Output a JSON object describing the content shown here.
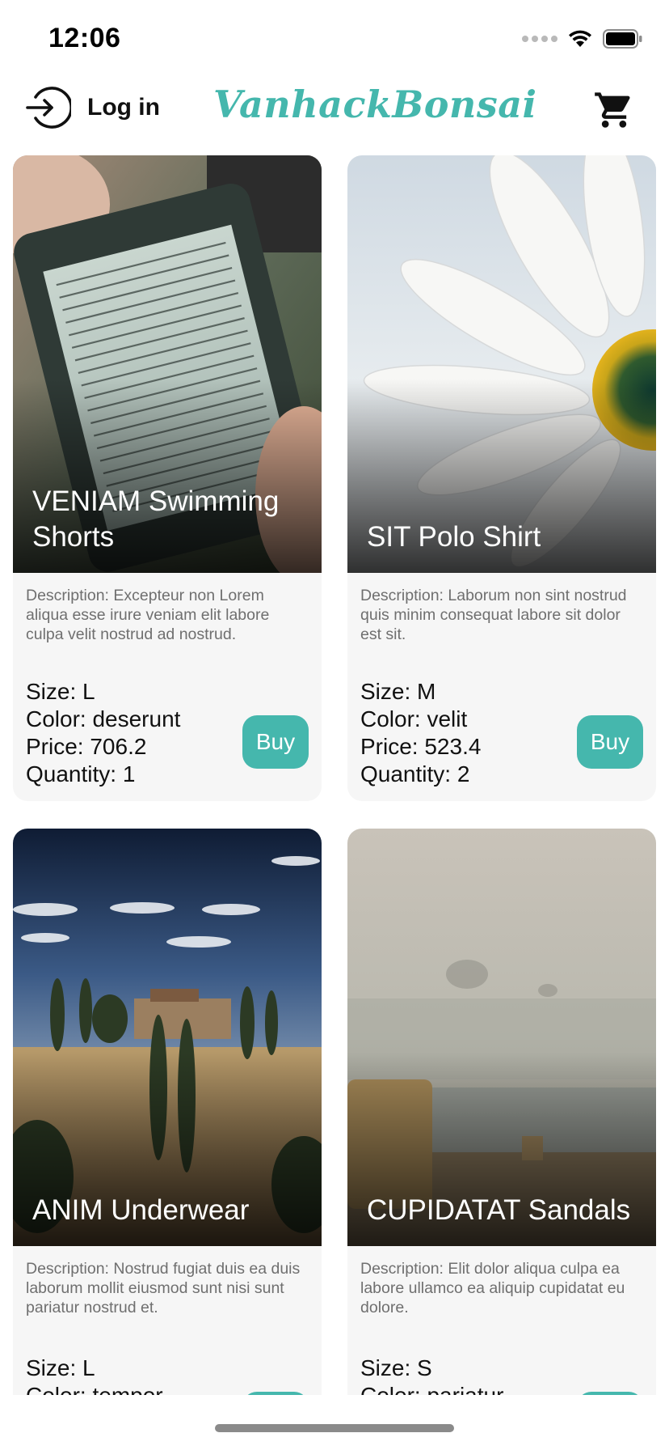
{
  "status_bar": {
    "time": "12:06"
  },
  "header": {
    "login_label": "Log in",
    "brand": "VanhackBonsai",
    "brand_color": "#45b7ad"
  },
  "icons": {
    "login": "login-arrow-icon",
    "cart": "shopping-cart-icon",
    "wifi": "wifi-icon",
    "battery": "battery-icon"
  },
  "labels": {
    "size": "Size: ",
    "color": "Color: ",
    "price": "Price: ",
    "quantity": "Quantity: ",
    "buy": "Buy"
  },
  "products": [
    {
      "title": "VENIAM Swimming Shorts",
      "image": "e-reader held in hand",
      "description": "Description: Excepteur non Lorem aliqua esse irure veniam elit labore culpa velit nostrud ad nostrud.",
      "size": "L",
      "color": "deserunt",
      "price": "706.2",
      "quantity": "1"
    },
    {
      "title": "SIT Polo Shirt",
      "image": "white daisy close-up",
      "description": "Description: Laborum non sint nostrud quis minim consequat labore sit dolor est sit.",
      "size": "M",
      "color": "velit",
      "price": "523.4",
      "quantity": "2"
    },
    {
      "title": "ANIM Underwear",
      "image": "tuscan field with cypress trees",
      "description": "Description: Nostrud fugiat duis ea duis laborum mollit eiusmod sunt nisi sunt pariatur nostrud et.",
      "size": "L",
      "color": "tempor",
      "price": "",
      "quantity": ""
    },
    {
      "title": "CUPIDATAT Sandals",
      "image": "foggy field with hay bale",
      "description": "Description: Elit dolor aliqua culpa ea labore ullamco ea aliquip cupidatat eu dolore.",
      "size": "S",
      "color": "pariatur",
      "price": "",
      "quantity": ""
    }
  ]
}
